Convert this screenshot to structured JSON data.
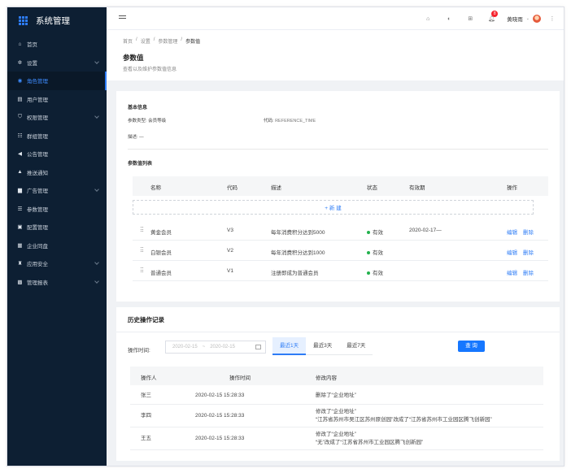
{
  "app": {
    "title": "系统管理"
  },
  "sidebar": {
    "items": [
      {
        "icon": "home-icon",
        "glyph": "⌂",
        "label": "首页",
        "has_children": false
      },
      {
        "icon": "gear-icon",
        "glyph": "✲",
        "label": "设置",
        "has_children": true
      },
      {
        "icon": "role-icon",
        "glyph": "◉",
        "label": "角色管理",
        "has_children": false,
        "active": true
      },
      {
        "icon": "user-icon",
        "glyph": "▤",
        "label": "用户管理",
        "has_children": false
      },
      {
        "icon": "shield-icon",
        "glyph": "⛉",
        "label": "权限管理",
        "has_children": true
      },
      {
        "icon": "group-icon",
        "glyph": "☷",
        "label": "群组管理",
        "has_children": false
      },
      {
        "icon": "megaphone-icon",
        "glyph": "◀",
        "label": "公告管理",
        "has_children": false
      },
      {
        "icon": "bell-icon",
        "glyph": "▲",
        "label": "推送通知",
        "has_children": false
      },
      {
        "icon": "ad-icon",
        "glyph": "▆",
        "label": "广告管理",
        "has_children": true
      },
      {
        "icon": "param-icon",
        "glyph": "☰",
        "label": "参数管理",
        "has_children": false
      },
      {
        "icon": "config-icon",
        "glyph": "▣",
        "label": "配置管理",
        "has_children": false
      },
      {
        "icon": "space-icon",
        "glyph": "▦",
        "label": "企业同盘",
        "has_children": false
      },
      {
        "icon": "lock-icon",
        "glyph": "♜",
        "label": "应用安全",
        "has_children": true
      },
      {
        "icon": "report-icon",
        "glyph": "▩",
        "label": "管理报表",
        "has_children": true
      }
    ]
  },
  "topbar": {
    "notification_count": "8",
    "username": "黄晓雨"
  },
  "breadcrumb": [
    "首页",
    "设置",
    "参数管理",
    "参数值"
  ],
  "page": {
    "title": "参数值",
    "subtitle": "查看以及维护参数值信息"
  },
  "basic": {
    "section_title": "基本信息",
    "type_label": "参数类型:",
    "type_value": "会员等级",
    "code_label": "代码:",
    "code_value": "REFERENCE_TIME",
    "desc_label": "描述:",
    "desc_value": "—"
  },
  "values": {
    "section_title": "参数值列表",
    "columns": [
      "名称",
      "代码",
      "描述",
      "状态",
      "有效期",
      "操作"
    ],
    "add_label": "+ 新 建",
    "edit_label": "编辑",
    "delete_label": "删除",
    "rows": [
      {
        "name": "黄金会员",
        "code": "V3",
        "desc": "每年消费积分达到5000",
        "status": "有效",
        "expiry": "2020-02-17—"
      },
      {
        "name": "白银会员",
        "code": "V2",
        "desc": "每年消费积分达到1000",
        "status": "有效",
        "expiry": ""
      },
      {
        "name": "普通会员",
        "code": "V1",
        "desc": "注册即成为普通会员",
        "status": "有效",
        "expiry": ""
      }
    ],
    "status_color": "#23b14d"
  },
  "history": {
    "title": "历史操作记录",
    "time_label": "操作时间:",
    "range_start": "2020-02-15",
    "range_sep": "~",
    "range_end": "2020-02-15",
    "quick_ranges": [
      "最近1天",
      "最近3天",
      "最近7天"
    ],
    "query_label": "查 询",
    "columns": [
      "操作人",
      "操作时间",
      "修改内容"
    ],
    "rows": [
      {
        "operator": "张三",
        "time": "2020-02-15 15:28:33",
        "content": [
          "删除了“企业地址”"
        ]
      },
      {
        "operator": "李四",
        "time": "2020-02-15 15:28:33",
        "content": [
          "修改了“企业地址”",
          "“江苏省苏州市吴江区苏州原创园”改成了“江苏省苏州市工业园区腾飞创新园”"
        ]
      },
      {
        "operator": "王五",
        "time": "2020-02-15 15:28:33",
        "content": [
          "修改了“企业地址”",
          "“无”改成了“江苏省苏州市工业园区腾飞创新园”"
        ]
      }
    ]
  },
  "colors": {
    "accent": "#2d7cf6",
    "sidebar_bg": "#0d1f33",
    "badge": "#f5222d"
  }
}
